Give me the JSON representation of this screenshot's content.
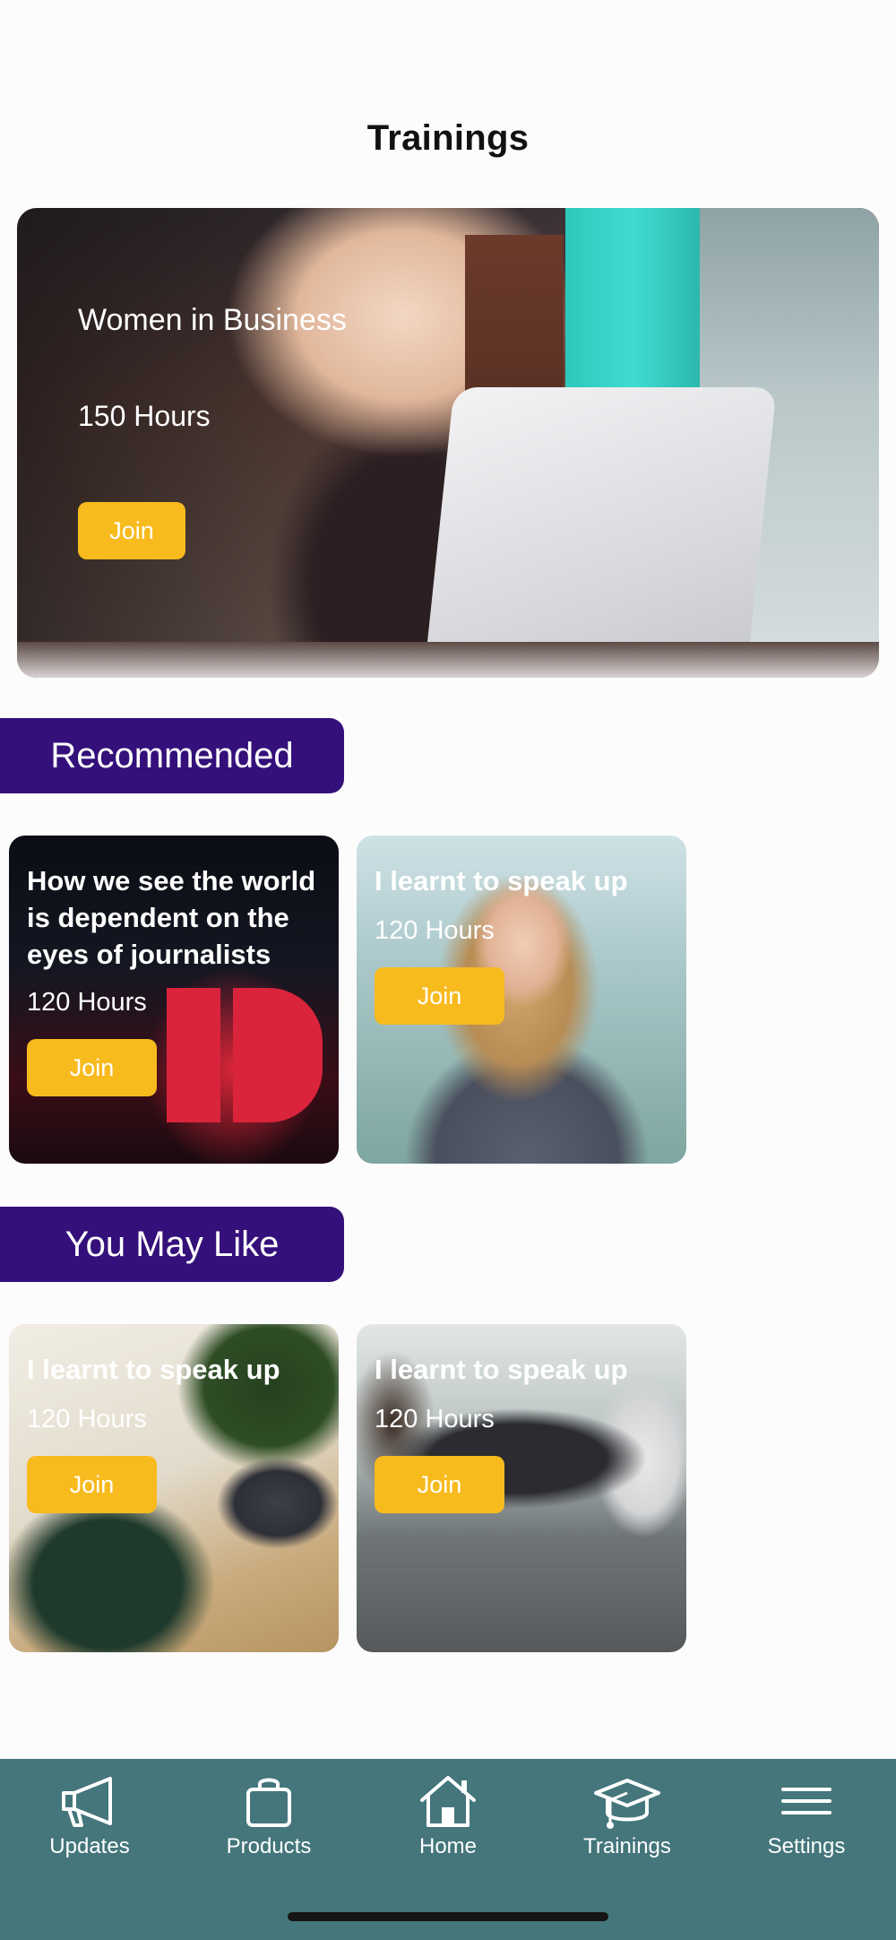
{
  "header": {
    "title": "Trainings"
  },
  "hero": {
    "title": "Women in Business",
    "hours": "150 Hours",
    "join_label": "Join"
  },
  "recommended": {
    "label": "Recommended",
    "cards": [
      {
        "title": "How we see the world is dependent on the eyes of journalists",
        "hours": "120 Hours",
        "join_label": "Join"
      },
      {
        "title": "I learnt to speak up",
        "hours": "120 Hours",
        "join_label": "Join"
      }
    ]
  },
  "you_may_like": {
    "label": "You May Like",
    "cards": [
      {
        "title": "I learnt to speak up",
        "hours": "120 Hours",
        "join_label": "Join"
      },
      {
        "title": "I learnt to speak up",
        "hours": "120 Hours",
        "join_label": "Join"
      }
    ]
  },
  "nav": {
    "items": [
      {
        "label": "Updates",
        "icon": "megaphone-icon"
      },
      {
        "label": "Products",
        "icon": "shopping-bag-icon"
      },
      {
        "label": "Home",
        "icon": "home-icon"
      },
      {
        "label": "Trainings",
        "icon": "graduation-cap-icon"
      },
      {
        "label": "Settings",
        "icon": "menu-icon"
      }
    ]
  },
  "colors": {
    "accent_yellow": "#f8bb1e",
    "section_purple": "#34107a",
    "nav_background": "#44767b"
  }
}
